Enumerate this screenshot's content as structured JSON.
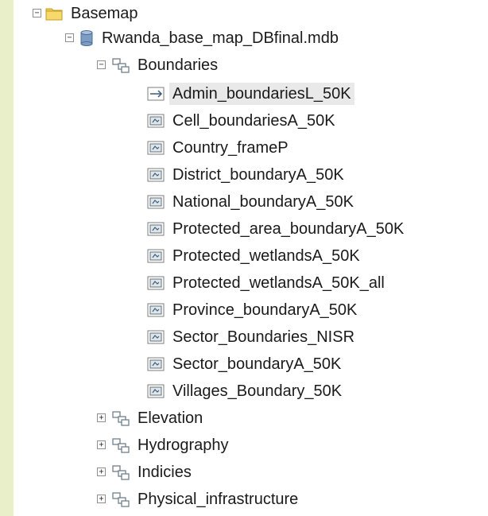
{
  "tree": {
    "root": {
      "label": "Basemap",
      "icon": "folder-icon",
      "toggle": "−"
    },
    "database": {
      "label": "Rwanda_base_map_DBfinal.mdb",
      "icon": "database-icon",
      "toggle": "−"
    },
    "expanded_dataset": {
      "label": "Boundaries",
      "icon": "feature-dataset-icon",
      "toggle": "−",
      "children": [
        {
          "label": "Admin_boundariesL_50K",
          "icon": "line-feature-class-icon",
          "selected": true
        },
        {
          "label": "Cell_boundariesA_50K",
          "icon": "polygon-feature-class-icon"
        },
        {
          "label": "Country_frameP",
          "icon": "polygon-feature-class-icon"
        },
        {
          "label": "District_boundaryA_50K",
          "icon": "polygon-feature-class-icon"
        },
        {
          "label": "National_boundaryA_50K",
          "icon": "polygon-feature-class-icon"
        },
        {
          "label": "Protected_area_boundaryA_50K",
          "icon": "polygon-feature-class-icon"
        },
        {
          "label": "Protected_wetlandsA_50K",
          "icon": "polygon-feature-class-icon"
        },
        {
          "label": "Protected_wetlandsA_50K_all",
          "icon": "polygon-feature-class-icon"
        },
        {
          "label": "Province_boundaryA_50K",
          "icon": "polygon-feature-class-icon"
        },
        {
          "label": "Sector_Boundaries_NISR",
          "icon": "polygon-feature-class-icon"
        },
        {
          "label": "Sector_boundaryA_50K",
          "icon": "polygon-feature-class-icon"
        },
        {
          "label": "Villages_Boundary_50K",
          "icon": "polygon-feature-class-icon"
        }
      ]
    },
    "collapsed_datasets": [
      {
        "label": "Elevation",
        "icon": "feature-dataset-icon",
        "toggle": "+"
      },
      {
        "label": "Hydrography",
        "icon": "feature-dataset-icon",
        "toggle": "+"
      },
      {
        "label": "Indicies",
        "icon": "feature-dataset-icon",
        "toggle": "+"
      },
      {
        "label": "Physical_infrastructure",
        "icon": "feature-dataset-icon",
        "toggle": "+"
      }
    ]
  },
  "colors": {
    "background": "#e8efc9",
    "folder": "#f0c94e",
    "database": "#6f8fb8",
    "dataset": "#6f7f8c",
    "selection": "#e9e9e9"
  }
}
